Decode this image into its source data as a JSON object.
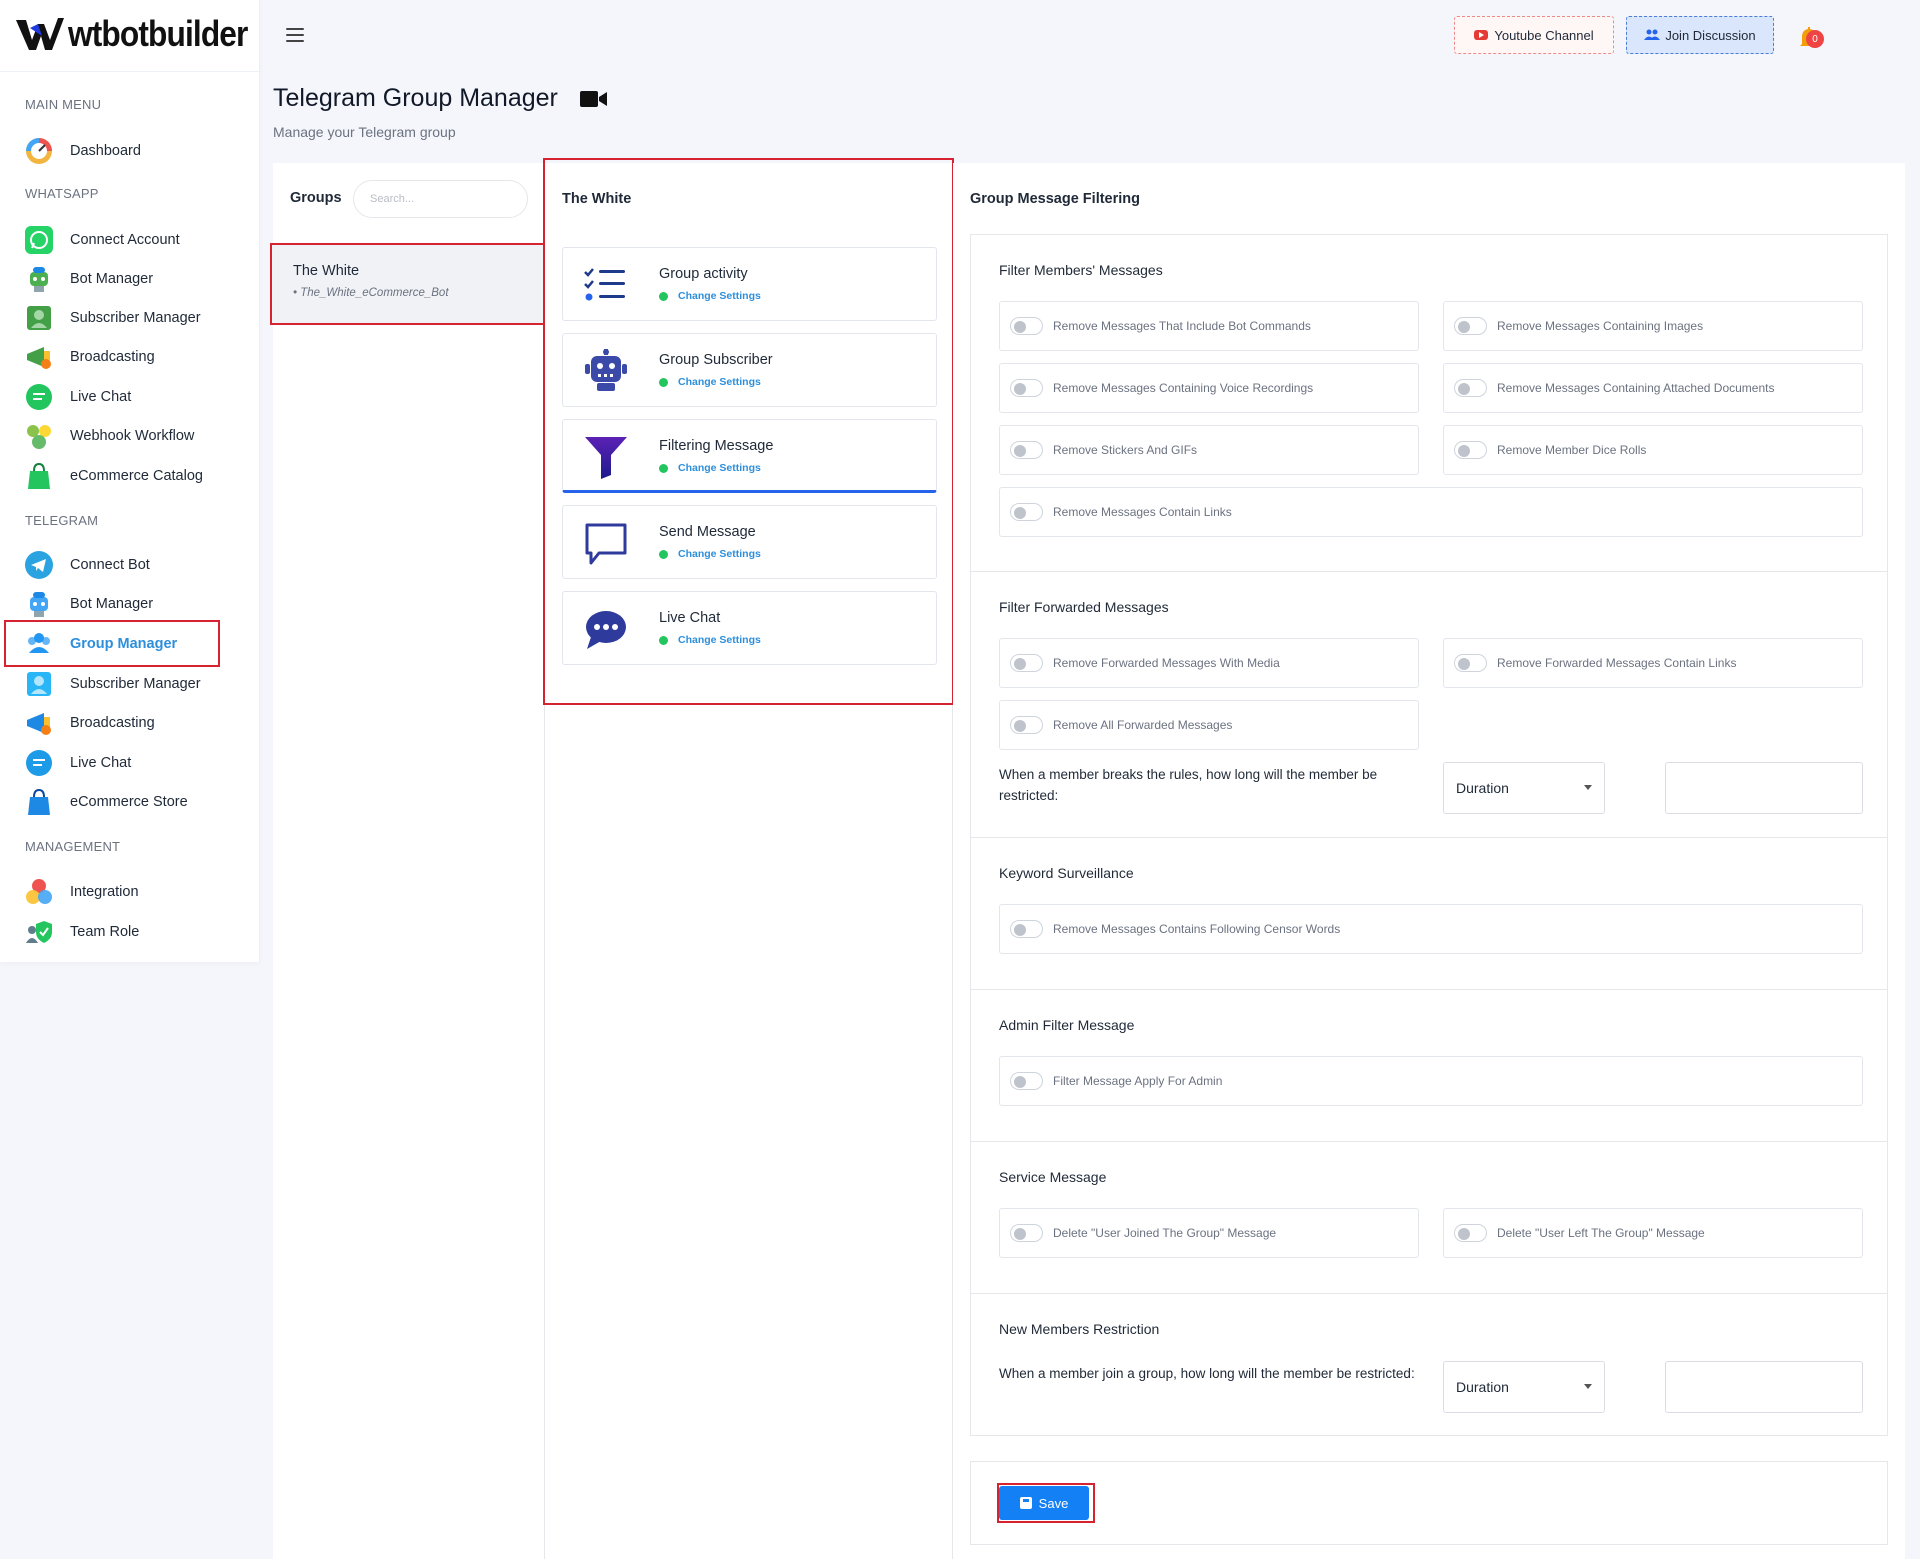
{
  "brand": {
    "name": "wtbotbuilder"
  },
  "sidebar": {
    "sections": {
      "main": "MAIN MENU",
      "whatsapp": "WHATSAPP",
      "telegram": "TELEGRAM",
      "management": "MANAGEMENT"
    },
    "main_items": [
      {
        "label": "Dashboard",
        "icon": "dashboard-gauge-icon"
      }
    ],
    "whatsapp_items": [
      {
        "label": "Connect Account",
        "icon": "whatsapp-icon"
      },
      {
        "label": "Bot Manager",
        "icon": "robot-icon"
      },
      {
        "label": "Subscriber Manager",
        "icon": "subscriber-icon"
      },
      {
        "label": "Broadcasting",
        "icon": "broadcast-icon"
      },
      {
        "label": "Live Chat",
        "icon": "chat-icon"
      },
      {
        "label": "Webhook Workflow",
        "icon": "webhook-icon"
      },
      {
        "label": "eCommerce Catalog",
        "icon": "shopping-bag-icon"
      }
    ],
    "telegram_items": [
      {
        "label": "Connect Bot",
        "icon": "telegram-icon"
      },
      {
        "label": "Bot Manager",
        "icon": "robot-icon"
      },
      {
        "label": "Group Manager",
        "icon": "group-icon",
        "active": true
      },
      {
        "label": "Subscriber Manager",
        "icon": "subscriber-icon"
      },
      {
        "label": "Broadcasting",
        "icon": "broadcast-icon"
      },
      {
        "label": "Live Chat",
        "icon": "chat-icon"
      },
      {
        "label": "eCommerce Store",
        "icon": "shopping-bag-icon"
      }
    ],
    "management_items": [
      {
        "label": "Integration",
        "icon": "integration-icon"
      },
      {
        "label": "Team Role",
        "icon": "team-role-icon"
      }
    ]
  },
  "topbar": {
    "youtube_label": "Youtube Channel",
    "join_label": "Join Discussion",
    "notification_count": "0"
  },
  "page": {
    "title": "Telegram Group Manager",
    "subtitle": "Manage your Telegram group"
  },
  "groups": {
    "header": "Groups",
    "search_placeholder": "Search...",
    "items": [
      {
        "name": "The White",
        "bot": "• The_White_eCommerce_Bot"
      }
    ]
  },
  "settings": {
    "title": "The White",
    "cards": [
      {
        "title": "Group activity",
        "link": "Change Settings",
        "icon": "checklist-icon"
      },
      {
        "title": "Group Subscriber",
        "link": "Change Settings",
        "icon": "robot-icon"
      },
      {
        "title": "Filtering Message",
        "link": "Change Settings",
        "icon": "funnel-icon",
        "active": true
      },
      {
        "title": "Send Message",
        "link": "Change Settings",
        "icon": "message-bubble-icon"
      },
      {
        "title": "Live Chat",
        "link": "Change Settings",
        "icon": "chat-bubble-icon"
      }
    ]
  },
  "filtering": {
    "title": "Group Message Filtering",
    "members": {
      "title": "Filter Members' Messages",
      "toggles": [
        "Remove Messages That Include Bot Commands",
        "Remove Messages Containing Images",
        "Remove Messages Containing Voice Recordings",
        "Remove Messages Containing Attached Documents",
        "Remove Stickers And GIFs",
        "Remove Member Dice Rolls",
        "Remove Messages Contain Links"
      ]
    },
    "forwarded": {
      "title": "Filter Forwarded Messages",
      "toggles": [
        "Remove Forwarded Messages With Media",
        "Remove Forwarded Messages Contain Links",
        "Remove All Forwarded Messages"
      ],
      "rule_text": "When a member breaks the rules, how long will the member be restricted:",
      "duration_value": "Duration"
    },
    "keyword": {
      "title": "Keyword Surveillance",
      "toggles": [
        "Remove Messages Contains Following Censor Words"
      ]
    },
    "admin": {
      "title": "Admin Filter Message",
      "toggles": [
        "Filter Message Apply For Admin"
      ]
    },
    "service": {
      "title": "Service Message",
      "toggles": [
        "Delete \"User Joined The Group\" Message",
        "Delete \"User Left The Group\" Message"
      ]
    },
    "new_members": {
      "title": "New Members Restriction",
      "rule_text": "When a member join a group, how long will the member be restricted:",
      "duration_value": "Duration"
    },
    "save_label": "Save"
  },
  "colors": {
    "accent": "#2d8fdc",
    "highlight": "#d62332",
    "save": "#1380f5"
  }
}
